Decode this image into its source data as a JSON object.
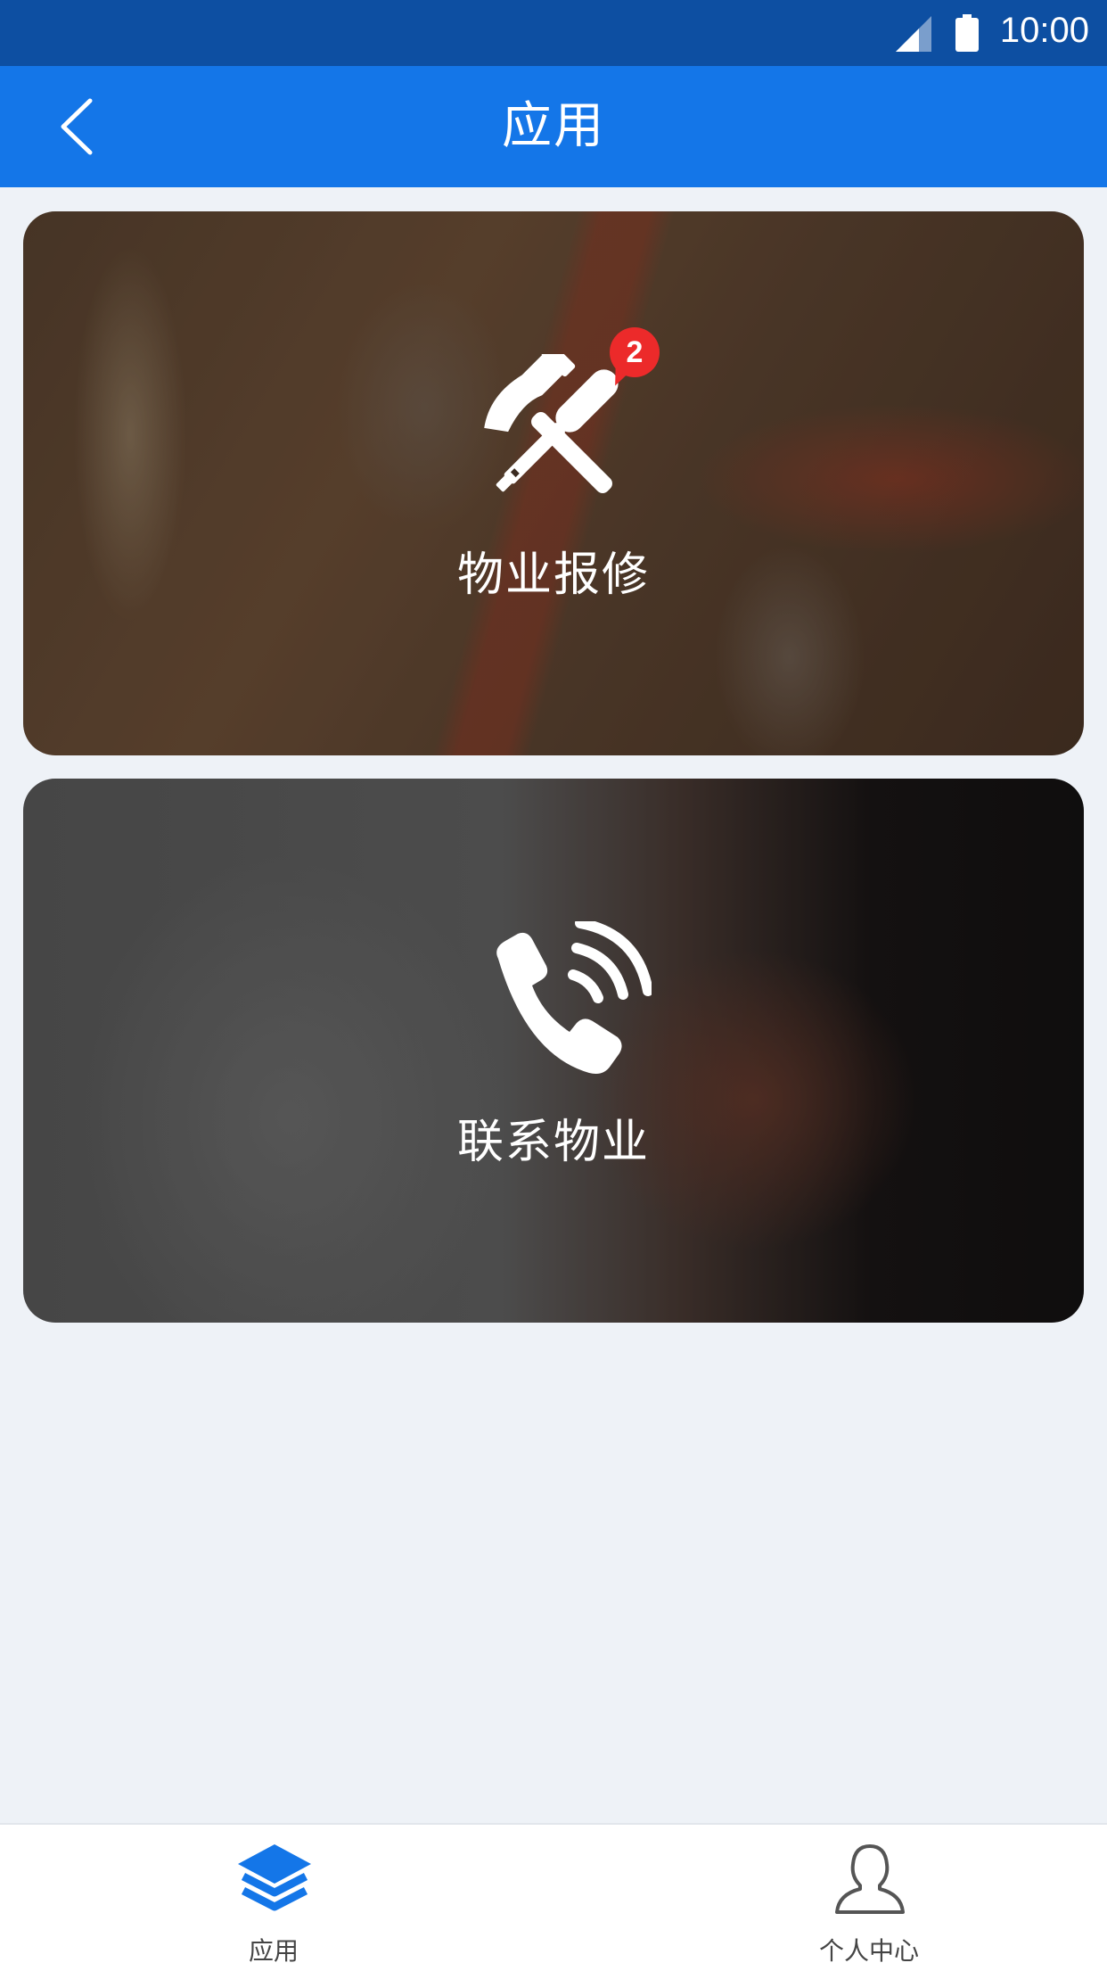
{
  "status_bar": {
    "time": "10:00",
    "signal_icon": "signal-icon",
    "battery_icon": "battery-icon"
  },
  "header": {
    "title": "应用",
    "back_icon": "chevron-left-icon"
  },
  "cards": [
    {
      "label": "物业报修",
      "icon": "repair-tools-icon",
      "badge_count": "2"
    },
    {
      "label": "联系物业",
      "icon": "phone-call-icon"
    }
  ],
  "bottom_nav": {
    "tabs": [
      {
        "label": "应用",
        "icon": "layers-icon",
        "active": true
      },
      {
        "label": "个人中心",
        "icon": "user-icon",
        "active": false
      }
    ]
  },
  "colors": {
    "status_bar": "#0d4fa2",
    "header": "#1476e8",
    "background": "#eef2f7",
    "badge": "#ec2a2a",
    "active_tab": "#1476e8"
  }
}
